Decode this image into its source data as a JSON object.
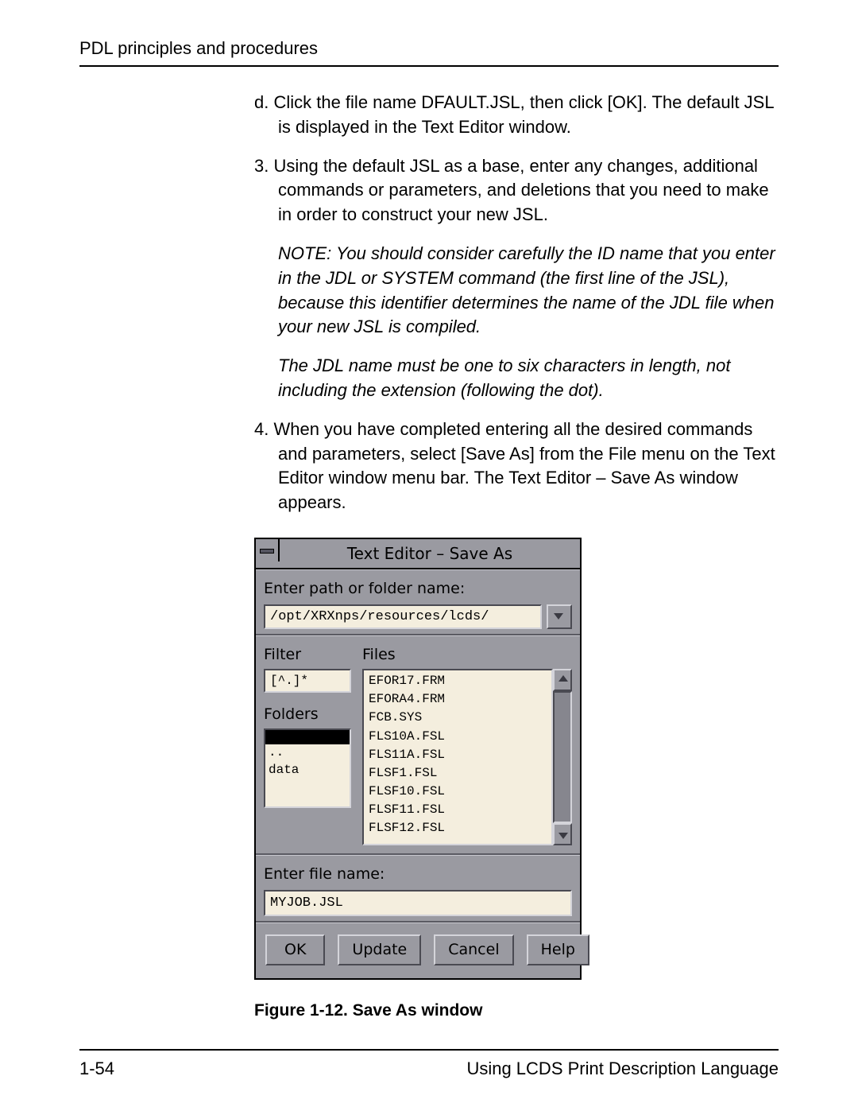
{
  "header": "PDL principles and procedures",
  "body": {
    "item_d": "d.  Click the file name DFAULT.JSL, then click [OK]. The default JSL is displayed in the Text Editor window.",
    "item_3": "3.  Using the default JSL as a base, enter any changes, additional commands or parameters, and deletions that you need to make in order to construct your new JSL.",
    "note1": "NOTE:  You should consider carefully the ID name that you enter in the JDL or SYSTEM command (the first line of the JSL), because this identifier determines the name of the JDL file when your new JSL is compiled.",
    "note2": "The JDL name must be one to six characters in length, not including the extension (following the dot).",
    "item_4": "4.  When you have completed entering all the desired commands and parameters, select [Save As] from the File menu on the Text Editor window menu bar. The Text Editor – Save As window appears."
  },
  "dialog": {
    "title": "Text Editor – Save As",
    "path_label": "Enter path or folder name:",
    "path_value": "/opt/XRXnps/resources/lcds/",
    "filter_label": "Filter",
    "filter_value": "[^.]*",
    "folders_label": "Folders",
    "folders": [
      ".",
      "..",
      "data"
    ],
    "files_label": "Files",
    "files": [
      "EFOR17.FRM",
      "EFORA4.FRM",
      "FCB.SYS",
      "FLS10A.FSL",
      "FLS11A.FSL",
      "FLSF1.FSL",
      "FLSF10.FSL",
      "FLSF11.FSL",
      "FLSF12.FSL"
    ],
    "filename_label": "Enter file name:",
    "filename_value": "MYJOB.JSL",
    "buttons": {
      "ok": "OK",
      "update": "Update",
      "cancel": "Cancel",
      "help": "Help"
    }
  },
  "caption": "Figure 1-12.  Save As window",
  "footer": {
    "left": "1-54",
    "right": "Using LCDS Print Description Language"
  }
}
